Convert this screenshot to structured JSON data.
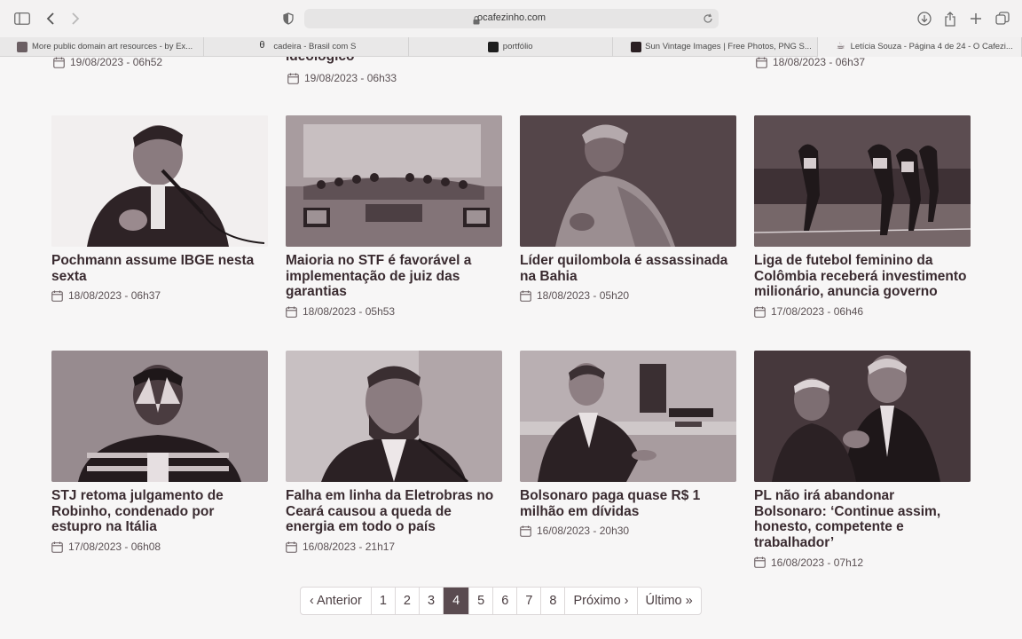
{
  "browser": {
    "url": "ocafezinho.com",
    "tabs": [
      {
        "title": "More public domain art resources - by Ex...",
        "favicon_color": "#6b5f63"
      },
      {
        "title": "cadeira - Brasil com S",
        "favicon_color": "#2b2b2b",
        "favicon_glyph": "θ"
      },
      {
        "title": "portfólio",
        "favicon_color": "#1e1e1e"
      },
      {
        "title": "Sun Vintage Images | Free Photos, PNG S...",
        "favicon_color": "#2a1f22"
      },
      {
        "title": "Letícia Souza - Página 4 de 24 - O Cafezi...",
        "favicon_color": "#ffffff",
        "favicon_glyph": "☕"
      }
    ]
  },
  "top_partial": {
    "col1_date": "19/08/2023 - 06h52",
    "col2_title_tail": "ideológico",
    "col2_date": "19/08/2023 - 06h33",
    "col4_date": "18/08/2023 - 06h37"
  },
  "articles": [
    {
      "title": "Pochmann assume IBGE nesta sexta",
      "date": "18/08/2023 - 06h37"
    },
    {
      "title": "Maioria no STF é favorável a implementação de juiz das garantias",
      "date": "18/08/2023 - 05h53"
    },
    {
      "title": "Líder quilombola é assassinada na Bahia",
      "date": "18/08/2023 - 05h20"
    },
    {
      "title": "Liga de futebol feminino da Colômbia receberá investimento milionário, anuncia governo",
      "date": "17/08/2023 - 06h46"
    },
    {
      "title": "STJ retoma julgamento de Robinho, condenado por estupro na Itália",
      "date": "17/08/2023 - 06h08"
    },
    {
      "title": "Falha em linha da Eletrobras no Ceará causou a queda de energia em todo o país",
      "date": "16/08/2023 - 21h17"
    },
    {
      "title": "Bolsonaro paga quase R$ 1 milhão em dívidas",
      "date": "16/08/2023 - 20h30"
    },
    {
      "title": "PL não irá abandonar Bolsonaro: ‘Continue assim, honesto, competente e trabalhador’",
      "date": "16/08/2023 - 07h12"
    }
  ],
  "pagination": {
    "prev": "‹ Anterior",
    "pages": [
      "1",
      "2",
      "3",
      "4",
      "5",
      "6",
      "7",
      "8"
    ],
    "current": "4",
    "next": "Próximo ›",
    "last": "Último »"
  },
  "colors": {
    "accent": "#5a4b50",
    "text": "#3a2b30",
    "background": "#f7f6f6"
  }
}
